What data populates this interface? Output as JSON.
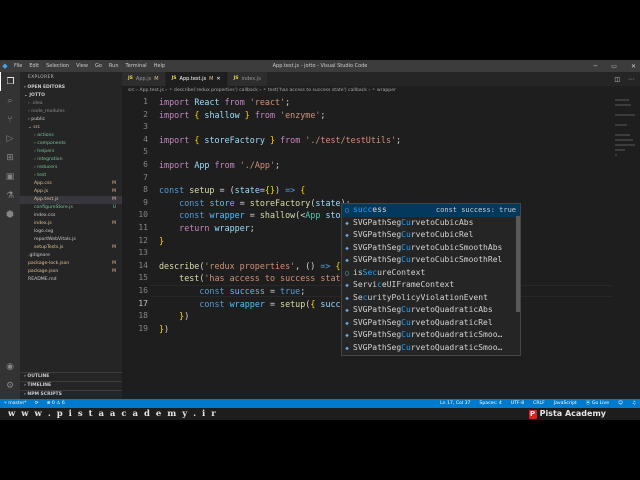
{
  "titlebar": {
    "menu": [
      "File",
      "Edit",
      "Selection",
      "View",
      "Go",
      "Run",
      "Terminal",
      "Help"
    ],
    "window_title": "App.test.js - jotto - Visual Studio Code"
  },
  "sidebar": {
    "header": "EXPLORER",
    "open_editors": "OPEN EDITORS",
    "project": "JOTTO",
    "items": [
      {
        "label": "› .idea",
        "indent": 1,
        "badge": "",
        "color": "#8c8c8c"
      },
      {
        "label": "› node_modules",
        "indent": 1,
        "badge": "",
        "color": "#8c8c8c"
      },
      {
        "label": "› public",
        "indent": 1,
        "badge": "",
        "color": "#cccccc"
      },
      {
        "label": "⌄ src",
        "indent": 1,
        "badge": "",
        "color": "#e2c08d"
      },
      {
        "label": "› actions",
        "indent": 2,
        "badge": "",
        "color": "#73c991"
      },
      {
        "label": "› components",
        "indent": 2,
        "badge": "",
        "color": "#73c991"
      },
      {
        "label": "› helpers",
        "indent": 2,
        "badge": "",
        "color": "#73c991"
      },
      {
        "label": "› integration",
        "indent": 2,
        "badge": "",
        "color": "#73c991"
      },
      {
        "label": "› reducers",
        "indent": 2,
        "badge": "",
        "color": "#73c991"
      },
      {
        "label": "› test",
        "indent": 2,
        "badge": "",
        "color": "#73c991"
      },
      {
        "label": "App.css",
        "indent": 2,
        "badge": "M",
        "color": "#e2c08d"
      },
      {
        "label": "App.js",
        "indent": 2,
        "badge": "M",
        "color": "#e2c08d"
      },
      {
        "label": "App.test.js",
        "indent": 2,
        "badge": "M",
        "color": "#e2c08d",
        "selected": true
      },
      {
        "label": "configureStore.js",
        "indent": 2,
        "badge": "U",
        "color": "#73c991"
      },
      {
        "label": "index.css",
        "indent": 2,
        "badge": "",
        "color": "#cccccc"
      },
      {
        "label": "index.js",
        "indent": 2,
        "badge": "M",
        "color": "#e2c08d"
      },
      {
        "label": "logo.svg",
        "indent": 2,
        "badge": "",
        "color": "#cccccc"
      },
      {
        "label": "reportWebVitals.js",
        "indent": 2,
        "badge": "",
        "color": "#cccccc"
      },
      {
        "label": "setupTests.js",
        "indent": 2,
        "badge": "M",
        "color": "#e2c08d"
      },
      {
        "label": ".gitignore",
        "indent": 1,
        "badge": "",
        "color": "#cccccc"
      },
      {
        "label": "package-lock.json",
        "indent": 1,
        "badge": "M",
        "color": "#e2c08d"
      },
      {
        "label": "package.json",
        "indent": 1,
        "badge": "M",
        "color": "#e2c08d"
      },
      {
        "label": "README.md",
        "indent": 1,
        "badge": "",
        "color": "#cccccc"
      }
    ],
    "outline": "OUTLINE",
    "timeline": "TIMELINE",
    "npm_scripts": "NPM SCRIPTS"
  },
  "tabs": [
    {
      "label": "App.js",
      "mod": "M",
      "active": false
    },
    {
      "label": "App.test.js",
      "mod": "M",
      "active": true
    },
    {
      "label": "index.js",
      "mod": "",
      "active": false
    }
  ],
  "breadcrumb": "src  ›  App.test.js  ›  ⚬ describe('redux properties') callback  ›  ⚬ test('has access to success state') callback  ›  ⚬ wrapper",
  "line_numbers": [
    "1",
    "2",
    "3",
    "4",
    "5",
    "6",
    "7",
    "8",
    "9",
    "10",
    "11",
    "12",
    "13",
    "14",
    "15",
    "16",
    "17",
    "18",
    "19"
  ],
  "current_line": "17",
  "suggest": {
    "detail": "const success: true",
    "items": [
      {
        "pre": "",
        "hl": "succ",
        "post": "ess",
        "icon": "variable"
      },
      {
        "pre": "SVGPathSeg",
        "hl": "Cu",
        "post": "rvetoCubicAbs",
        "icon": "class"
      },
      {
        "pre": "SVGPathSeg",
        "hl": "Cu",
        "post": "rvetoCubicRel",
        "icon": "class"
      },
      {
        "pre": "SVGPathSeg",
        "hl": "Cu",
        "post": "rvetoCubicSmoothAbs",
        "icon": "class"
      },
      {
        "pre": "SVGPathSeg",
        "hl": "Cu",
        "post": "rvetoCubicSmoothRel",
        "icon": "class"
      },
      {
        "pre": "is",
        "hl": "Sec",
        "post": "ureContext",
        "icon": "variable"
      },
      {
        "pre": "Servi",
        "hl": "c",
        "post": "eUIFrameContext",
        "icon": "class"
      },
      {
        "pre": "Se",
        "hl": "c",
        "post": "urityPolicyViolationEvent",
        "icon": "class"
      },
      {
        "pre": "SVGPathSeg",
        "hl": "Cu",
        "post": "rvetoQuadraticAbs",
        "icon": "class"
      },
      {
        "pre": "SVGPathSeg",
        "hl": "Cu",
        "post": "rvetoQuadraticRel",
        "icon": "class"
      },
      {
        "pre": "SVGPathSeg",
        "hl": "Cu",
        "post": "rvetoQuadraticSmoo…",
        "icon": "class"
      },
      {
        "pre": "SVGPathSeg",
        "hl": "Cu",
        "post": "rvetoQuadraticSmoo…",
        "icon": "class"
      }
    ]
  },
  "status": {
    "branch": "master*",
    "sync": "⟳",
    "problems": "⊗ 0 ⚠ 6",
    "position": "Ln 17, Col 37",
    "spaces": "Spaces: 4",
    "encoding": "UTF-8",
    "eol": "CRLF",
    "language": "JavaScript",
    "golive": "Go Live"
  },
  "banner": {
    "url": "w w w . p i s t a a c a d e m y . i r",
    "brand": "Pista Academy"
  }
}
